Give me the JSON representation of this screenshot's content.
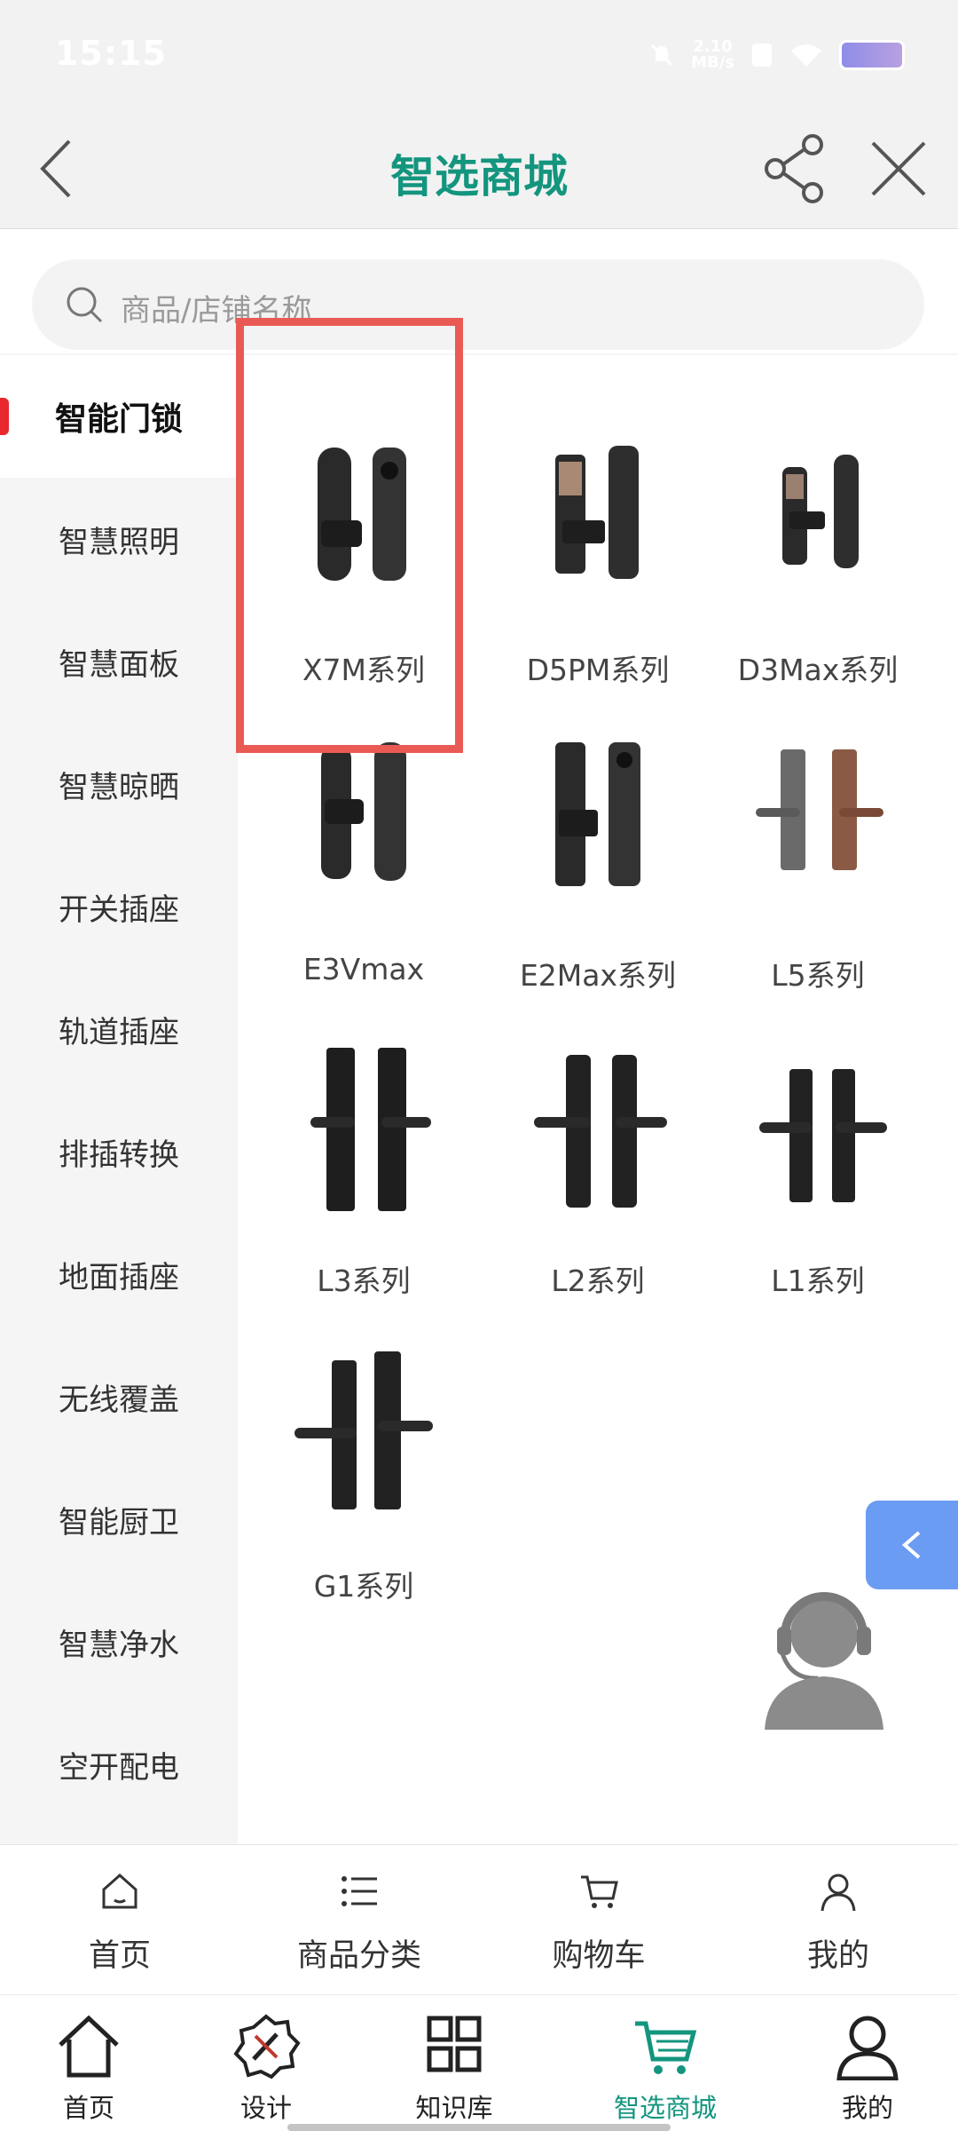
{
  "status_bar": {
    "time": "15:15",
    "net_speed_value": "2.10",
    "net_speed_unit": "MB/s"
  },
  "header": {
    "title": "智选商城"
  },
  "search": {
    "placeholder": "商品/店铺名称"
  },
  "sidebar": {
    "items": [
      {
        "label": "智能门锁",
        "active": true
      },
      {
        "label": "智慧照明"
      },
      {
        "label": "智慧面板"
      },
      {
        "label": "智慧晾晒"
      },
      {
        "label": "开关插座"
      },
      {
        "label": "轨道插座"
      },
      {
        "label": "排插转换"
      },
      {
        "label": "地面插座"
      },
      {
        "label": "无线覆盖"
      },
      {
        "label": "智能厨卫"
      },
      {
        "label": "智慧净水"
      },
      {
        "label": "空开配电"
      }
    ]
  },
  "products": [
    {
      "name": "X7M系列",
      "icon": "push-pull-lock-icon"
    },
    {
      "name": "D5PM系列",
      "icon": "video-lock-icon"
    },
    {
      "name": "D3Max系列",
      "icon": "video-lock-icon"
    },
    {
      "name": "E3Vmax",
      "icon": "push-pull-lock-icon"
    },
    {
      "name": "E2Max系列",
      "icon": "push-pull-lock-icon"
    },
    {
      "name": "L5系列",
      "icon": "handle-lock-icon"
    },
    {
      "name": "L3系列",
      "icon": "handle-lock-icon"
    },
    {
      "name": "L2系列",
      "icon": "handle-lock-icon"
    },
    {
      "name": "L1系列",
      "icon": "handle-lock-icon"
    },
    {
      "name": "G1系列",
      "icon": "handle-lock-icon"
    }
  ],
  "store_tabs": [
    {
      "label": "首页",
      "icon": "home-icon"
    },
    {
      "label": "商品分类",
      "icon": "list-icon"
    },
    {
      "label": "购物车",
      "icon": "cart-icon"
    },
    {
      "label": "我的",
      "icon": "user-icon"
    }
  ],
  "app_nav": [
    {
      "label": "首页",
      "icon": "home-icon"
    },
    {
      "label": "设计",
      "icon": "design-icon"
    },
    {
      "label": "知识库",
      "icon": "grid-icon"
    },
    {
      "label": "智选商城",
      "icon": "cart-icon",
      "active": true
    },
    {
      "label": "我的",
      "icon": "user-icon"
    }
  ],
  "colors": {
    "accent": "#13957e",
    "highlight": "#ea5a55",
    "active_indicator": "#e8272e",
    "float_tab": "#6b9cf3"
  }
}
